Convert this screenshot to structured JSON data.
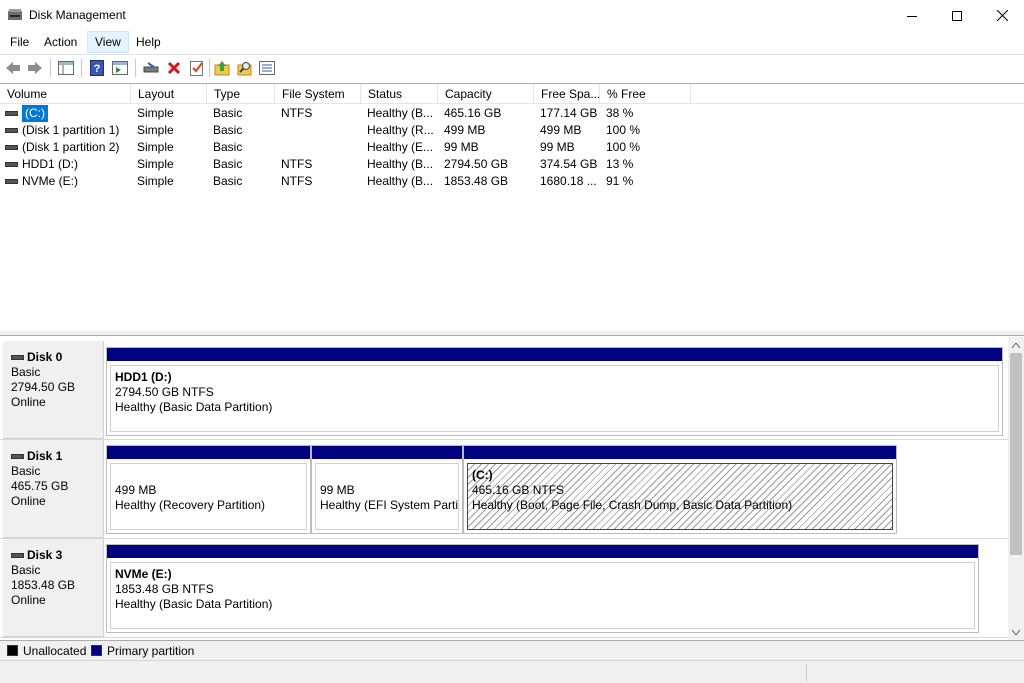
{
  "window": {
    "title": "Disk Management"
  },
  "menu": {
    "items": [
      "File",
      "Action",
      "View",
      "Help"
    ],
    "active": "View"
  },
  "toolbar": {
    "icons": [
      "back-icon",
      "forward-icon",
      "list-view-icon",
      "help-icon",
      "properties-view-icon",
      "connect-icon",
      "delete-icon",
      "check-icon",
      "up-icon",
      "search-icon",
      "details-icon"
    ]
  },
  "volume_list": {
    "columns": [
      "Volume",
      "Layout",
      "Type",
      "File System",
      "Status",
      "Capacity",
      "Free Spa...",
      "% Free"
    ],
    "rows": [
      {
        "volume": "(C:)",
        "layout": "Simple",
        "type": "Basic",
        "fs": "NTFS",
        "status": "Healthy (B...",
        "capacity": "465.16 GB",
        "free": "177.14 GB",
        "pct": "38 %",
        "selected": true
      },
      {
        "volume": "(Disk 1 partition 1)",
        "layout": "Simple",
        "type": "Basic",
        "fs": "",
        "status": "Healthy (R...",
        "capacity": "499 MB",
        "free": "499 MB",
        "pct": "100 %",
        "selected": false
      },
      {
        "volume": "(Disk 1 partition 2)",
        "layout": "Simple",
        "type": "Basic",
        "fs": "",
        "status": "Healthy (E...",
        "capacity": "99 MB",
        "free": "99 MB",
        "pct": "100 %",
        "selected": false
      },
      {
        "volume": "HDD1 (D:)",
        "layout": "Simple",
        "type": "Basic",
        "fs": "NTFS",
        "status": "Healthy (B...",
        "capacity": "2794.50 GB",
        "free": "374.54 GB",
        "pct": "13 %",
        "selected": false
      },
      {
        "volume": "NVMe (E:)",
        "layout": "Simple",
        "type": "Basic",
        "fs": "NTFS",
        "status": "Healthy (B...",
        "capacity": "1853.48 GB",
        "free": "1680.18 ...",
        "pct": "91 %",
        "selected": false
      }
    ]
  },
  "disks": [
    {
      "name": "Disk 0",
      "type": "Basic",
      "size": "2794.50 GB",
      "state": "Online",
      "partitions": [
        {
          "title": "HDD1  (D:)",
          "size": "2794.50 GB NTFS",
          "status": "Healthy (Basic Data Partition)",
          "hatched": false
        }
      ]
    },
    {
      "name": "Disk 1",
      "type": "Basic",
      "size": "465.75 GB",
      "state": "Online",
      "partitions": [
        {
          "title": "",
          "size": "499 MB",
          "status": "Healthy (Recovery Partition)",
          "hatched": false
        },
        {
          "title": "",
          "size": "99 MB",
          "status": "Healthy (EFI System Partit",
          "hatched": false
        },
        {
          "title": "(C:)",
          "size": "465.16 GB NTFS",
          "status": "Healthy (Boot, Page File, Crash Dump, Basic Data Partition)",
          "hatched": true
        }
      ]
    },
    {
      "name": "Disk 3",
      "type": "Basic",
      "size": "1853.48 GB",
      "state": "Online",
      "partitions": [
        {
          "title": "NVMe  (E:)",
          "size": "1853.48 GB NTFS",
          "status": "Healthy (Basic Data Partition)",
          "hatched": false
        }
      ]
    }
  ],
  "legend": {
    "unallocated": "Unallocated",
    "primary": "Primary partition",
    "colors": {
      "unallocated": "#000000",
      "primary": "#000080"
    }
  }
}
